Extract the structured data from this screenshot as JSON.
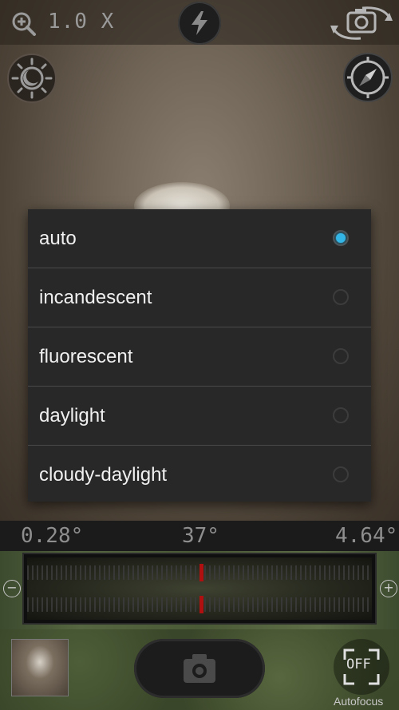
{
  "topbar": {
    "zoom_level": "1.0 X"
  },
  "white_balance_dialog": {
    "options": [
      {
        "label": "auto",
        "selected": true
      },
      {
        "label": "incandescent",
        "selected": false
      },
      {
        "label": "fluorescent",
        "selected": false
      },
      {
        "label": "daylight",
        "selected": false
      },
      {
        "label": "cloudy-daylight",
        "selected": false
      }
    ],
    "accent_color": "#33b5e5"
  },
  "readings": {
    "left": "0.28°",
    "center": "37°",
    "right": "4.64°"
  },
  "level_gauge": {
    "minus_label": "−",
    "plus_label": "+"
  },
  "bottombar": {
    "autofocus_state": "OFF",
    "autofocus_label": "Autofocus"
  },
  "icons": {
    "zoom": "zoom-in-icon",
    "flash": "flash-icon",
    "switch_camera": "switch-camera-icon",
    "white_balance": "white-balance-icon",
    "compass": "compass-icon",
    "shutter": "camera-icon"
  }
}
